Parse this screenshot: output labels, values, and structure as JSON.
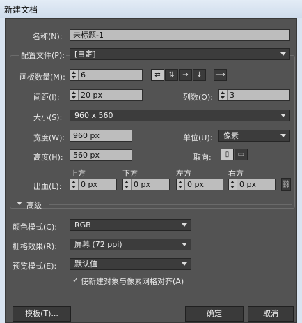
{
  "window": {
    "title": "新建文档"
  },
  "name": {
    "label": "名称(N):",
    "value": "未标题-1"
  },
  "profile": {
    "label": "配置文件(P):",
    "value": "[自定]"
  },
  "artboards": {
    "count_label": "画板数量(M):",
    "count_value": "6",
    "spacing_label": "间距(I):",
    "spacing_value": "20 px",
    "columns_label": "列数(O):",
    "columns_value": "3"
  },
  "size": {
    "label": "大小(S):",
    "value": "960 x 560"
  },
  "width": {
    "label": "宽度(W):",
    "value": "960 px"
  },
  "height": {
    "label": "高度(H):",
    "value": "560 px"
  },
  "units": {
    "label": "单位(U):",
    "value": "像素"
  },
  "orientation": {
    "label": "取向:"
  },
  "bleed": {
    "label": "出血(L):",
    "top_label": "上方",
    "top_value": "0 px",
    "bottom_label": "下方",
    "bottom_value": "0 px",
    "left_label": "左方",
    "left_value": "0 px",
    "right_label": "右方",
    "right_value": "0 px"
  },
  "advanced": {
    "label": "高级",
    "color_mode_label": "颜色模式(C):",
    "color_mode_value": "RGB",
    "raster_label": "栅格效果(R):",
    "raster_value": "屏幕 (72 ppi)",
    "preview_label": "预览模式(E):",
    "preview_value": "默认值",
    "align_checkbox": "使新建对象与像素网格对齐(A)"
  },
  "buttons": {
    "templates": "模板(T)...",
    "ok": "确定",
    "cancel": "取消"
  }
}
